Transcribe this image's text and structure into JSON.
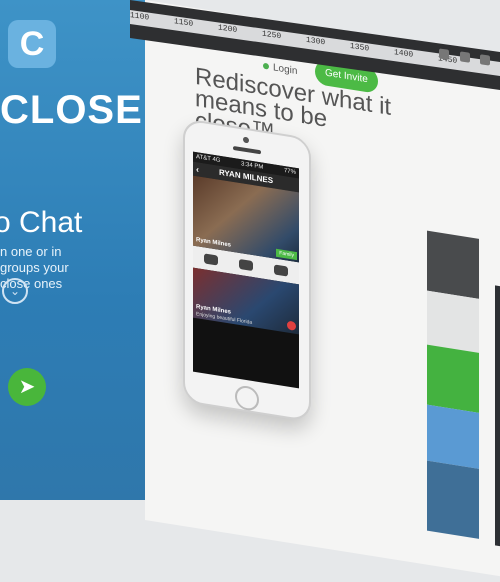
{
  "ruler": [
    "1100",
    "1150",
    "1200",
    "1250",
    "1300",
    "1350",
    "1400",
    "1450"
  ],
  "hero": {
    "logo_letter": "C",
    "brand": "CLOSE",
    "chat_title": "o Chat",
    "chat_sub": "n one or in groups your close ones"
  },
  "header": {
    "login_label": "Login",
    "invite_label": "Get Invite"
  },
  "main": {
    "headline": "Rediscover what it means to be close™"
  },
  "phone": {
    "carrier": "AT&T 4G",
    "time": "3:34 PM",
    "battery": "77%",
    "title": "RYAN MILNES",
    "photo1_name": "Ryan Milnes",
    "family_label": "Family",
    "photo2_name": "Ryan Milnes",
    "photo2_caption": "Enjoying beautiful Florida"
  },
  "colors": {
    "brand_blue": "#3e93c7",
    "green": "#4cba45",
    "dark_gray": "#494b4d",
    "light_gray": "#e3e4e4",
    "blue": "#5a9ad3",
    "deep_blue": "#3f6f97"
  }
}
